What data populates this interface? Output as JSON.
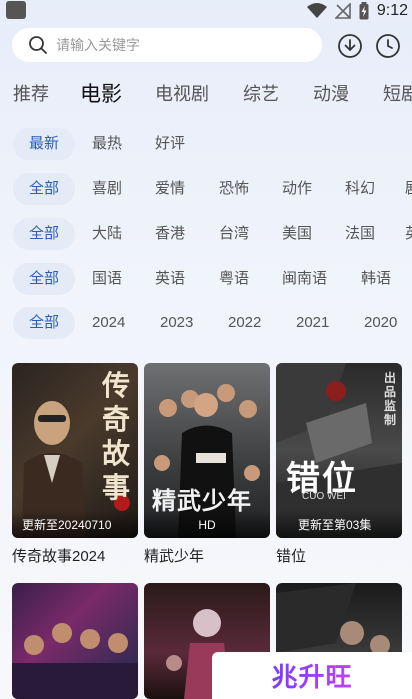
{
  "status_bar": {
    "time": "9:12"
  },
  "search": {
    "placeholder": "请输入关键字"
  },
  "main_tabs": [
    "推荐",
    "电影",
    "电视剧",
    "综艺",
    "动漫",
    "短剧"
  ],
  "filters": {
    "sort": [
      "最新",
      "最热",
      "好评"
    ],
    "genre": [
      "全部",
      "喜剧",
      "爱情",
      "恐怖",
      "动作",
      "科幻",
      "剧"
    ],
    "region": [
      "全部",
      "大陆",
      "香港",
      "台湾",
      "美国",
      "法国",
      "英"
    ],
    "language": [
      "全部",
      "国语",
      "英语",
      "粤语",
      "闽南语",
      "韩语"
    ],
    "year": [
      "全部",
      "2024",
      "2023",
      "2022",
      "2021",
      "2020"
    ]
  },
  "cards": [
    {
      "title": "传奇故事2024",
      "badge": "更新至20240710",
      "poster_text": "传奇故事"
    },
    {
      "title": "精武少年",
      "badge": "HD",
      "poster_text": "精武少年"
    },
    {
      "title": "错位",
      "badge": "更新至第03集",
      "poster_text": "错位",
      "poster_sub": "CUO WEI",
      "poster_side": "出品监制"
    }
  ],
  "watermark": "兆升旺",
  "colors": {
    "accent": "#2a5fb5",
    "chip_bg": "#e4ebf6",
    "watermark": "#9b3cff"
  }
}
